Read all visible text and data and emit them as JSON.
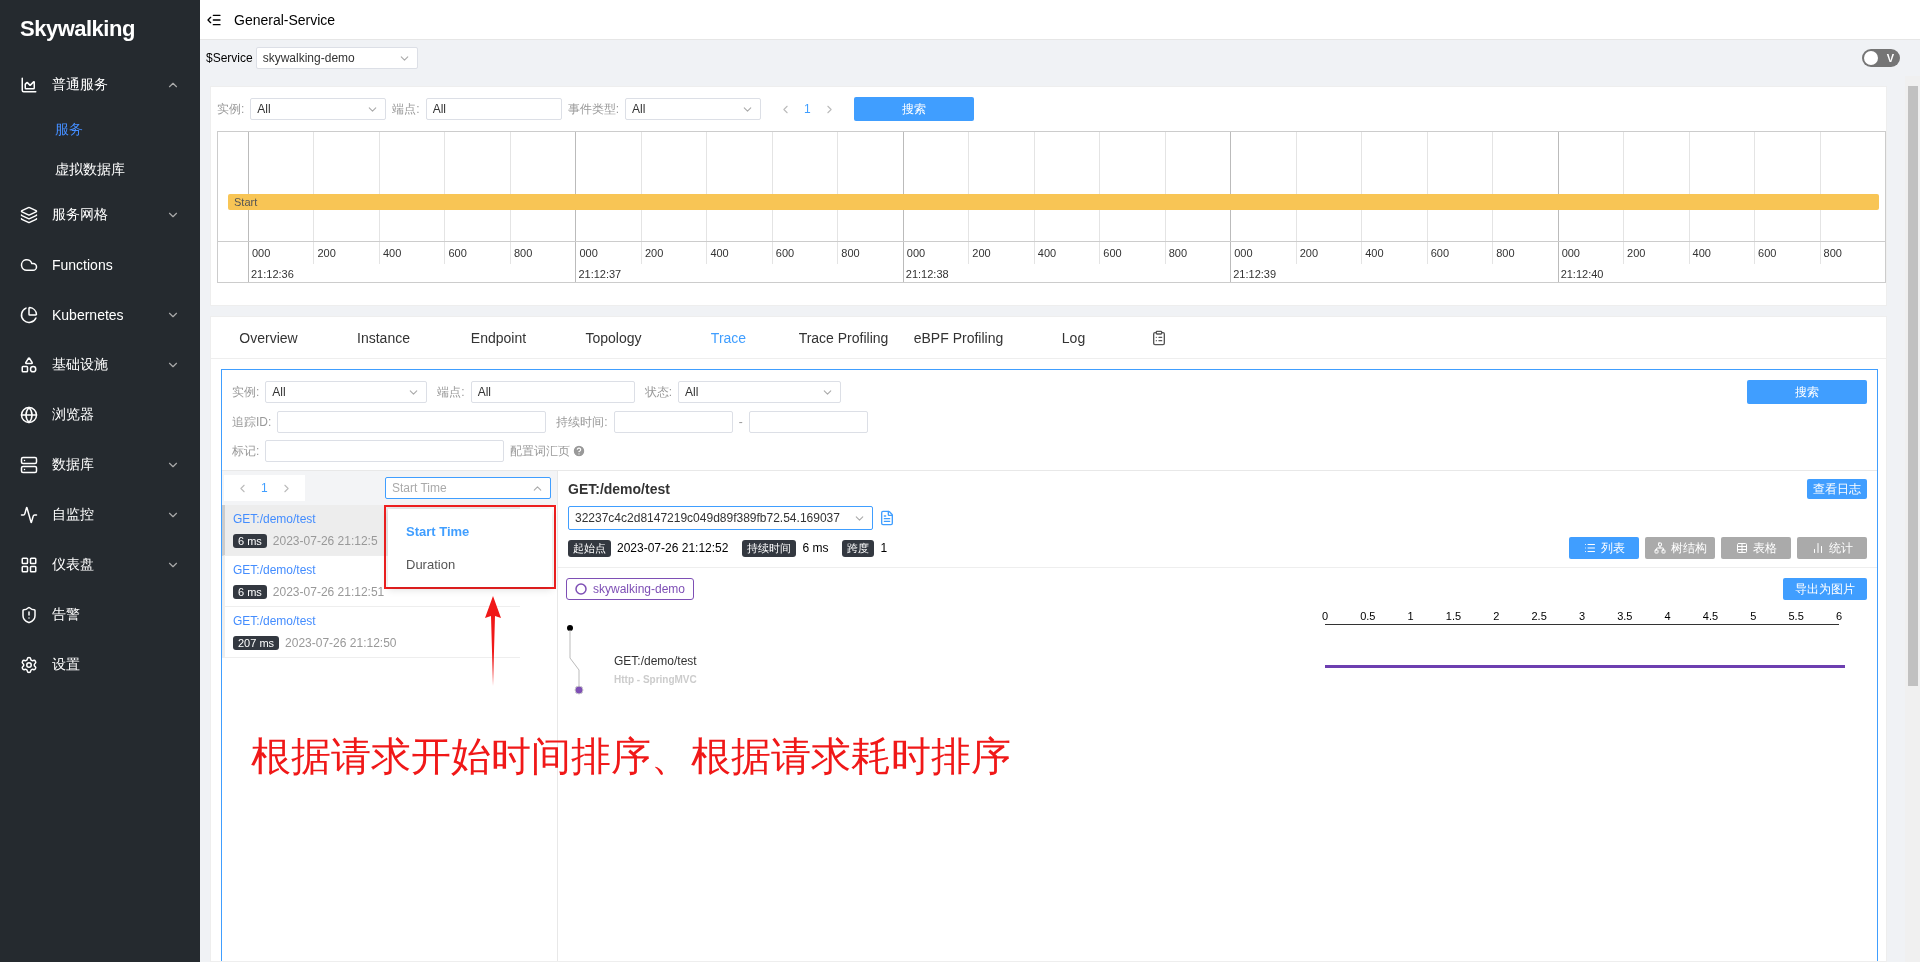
{
  "sidebar": {
    "logo": "Skywalking",
    "items": [
      {
        "label": "普通服务",
        "kind": "group",
        "expanded": true,
        "children": [
          {
            "label": "服务",
            "selected": true
          },
          {
            "label": "虚拟数据库",
            "selected": false
          }
        ]
      },
      {
        "label": "服务网格",
        "kind": "group",
        "expanded": false
      },
      {
        "label": "Functions",
        "kind": "link"
      },
      {
        "label": "Kubernetes",
        "kind": "group",
        "expanded": false
      },
      {
        "label": "基础设施",
        "kind": "group",
        "expanded": false
      },
      {
        "label": "浏览器",
        "kind": "link"
      },
      {
        "label": "数据库",
        "kind": "group",
        "expanded": false
      },
      {
        "label": "自监控",
        "kind": "group",
        "expanded": false
      },
      {
        "label": "仪表盘",
        "kind": "group",
        "expanded": false
      },
      {
        "label": "告警",
        "kind": "link"
      },
      {
        "label": "设置",
        "kind": "link"
      }
    ]
  },
  "header": {
    "title": "General-Service"
  },
  "service_bar": {
    "label": "$Service",
    "value": "skywalking-demo",
    "theme_switch": {
      "label": "V",
      "on": false
    }
  },
  "events": {
    "filters": [
      {
        "label": "实例:",
        "value": "All",
        "kind": "select"
      },
      {
        "label": "端点:",
        "value": "All",
        "kind": "input"
      },
      {
        "label": "事件类型:",
        "value": "All",
        "kind": "select"
      }
    ],
    "page": "1",
    "search": "搜索",
    "timeline": {
      "bar_label": "Start",
      "seconds": [
        {
          "time": "21:12:36",
          "ticks": [
            "000",
            "200",
            "400",
            "600",
            "800"
          ]
        },
        {
          "time": "21:12:37",
          "ticks": [
            "000",
            "200",
            "400",
            "600",
            "800"
          ]
        },
        {
          "time": "21:12:38",
          "ticks": [
            "000",
            "200",
            "400",
            "600",
            "800"
          ]
        },
        {
          "time": "21:12:39",
          "ticks": [
            "000",
            "200",
            "400",
            "600",
            "800"
          ]
        },
        {
          "time": "21:12:40",
          "ticks": [
            "000",
            "200",
            "400",
            "600",
            "800"
          ]
        }
      ]
    }
  },
  "tabs": [
    {
      "label": "Overview",
      "selected": false
    },
    {
      "label": "Instance",
      "selected": false
    },
    {
      "label": "Endpoint",
      "selected": false
    },
    {
      "label": "Topology",
      "selected": false
    },
    {
      "label": "Trace",
      "selected": true
    },
    {
      "label": "Trace Profiling",
      "selected": false
    },
    {
      "label": "eBPF Profiling",
      "selected": false
    },
    {
      "label": "Log",
      "selected": false
    }
  ],
  "trace": {
    "filters": {
      "instance": {
        "label": "实例:",
        "value": "All"
      },
      "endpoint": {
        "label": "端点:",
        "value": "All"
      },
      "status": {
        "label": "状态:",
        "value": "All"
      },
      "search": "搜索",
      "trace_id": {
        "label": "追踪ID:"
      },
      "duration": {
        "label": "持续时间:",
        "separator": "-"
      },
      "tags": {
        "label": "标记:",
        "link": "配置词汇页"
      }
    },
    "list": {
      "page": "1",
      "sort": {
        "placeholder": "Start Time",
        "options": [
          {
            "label": "Start Time",
            "selected": true
          },
          {
            "label": "Duration",
            "selected": false
          }
        ]
      },
      "rows": [
        {
          "endpoint": "GET:/demo/test",
          "duration": "6 ms",
          "time": "2023-07-26 21:12:5",
          "selected": true
        },
        {
          "endpoint": "GET:/demo/test",
          "duration": "6 ms",
          "time": "2023-07-26 21:12:51",
          "selected": false
        },
        {
          "endpoint": "GET:/demo/test",
          "duration": "207 ms",
          "time": "2023-07-26 21:12:50",
          "selected": false
        }
      ]
    },
    "detail": {
      "title": "GET:/demo/test",
      "trace_id": "32237c4c2d8147219c049d89f389fb72.54.169037",
      "view_logs": "查看日志",
      "stats": [
        {
          "label": "起始点",
          "value": "2023-07-26 21:12:52"
        },
        {
          "label": "持续时间",
          "value": "6 ms"
        },
        {
          "label": "跨度",
          "value": "1"
        }
      ],
      "views": [
        {
          "label": "列表",
          "selected": true
        },
        {
          "label": "树结构",
          "selected": false
        },
        {
          "label": "表格",
          "selected": false
        },
        {
          "label": "统计",
          "selected": false
        }
      ],
      "service": "skywalking-demo",
      "export": "导出为图片",
      "axis": [
        "0",
        "0.5",
        "1",
        "1.5",
        "2",
        "2.5",
        "3",
        "3.5",
        "4",
        "4.5",
        "5",
        "5.5",
        "6"
      ],
      "spans": [
        {
          "endpoint": "GET:/demo/test",
          "component": "Http - SpringMVC",
          "level": 1
        }
      ]
    }
  },
  "annotation": {
    "text": "根据请求开始时间排序、根据请求耗时排序"
  }
}
